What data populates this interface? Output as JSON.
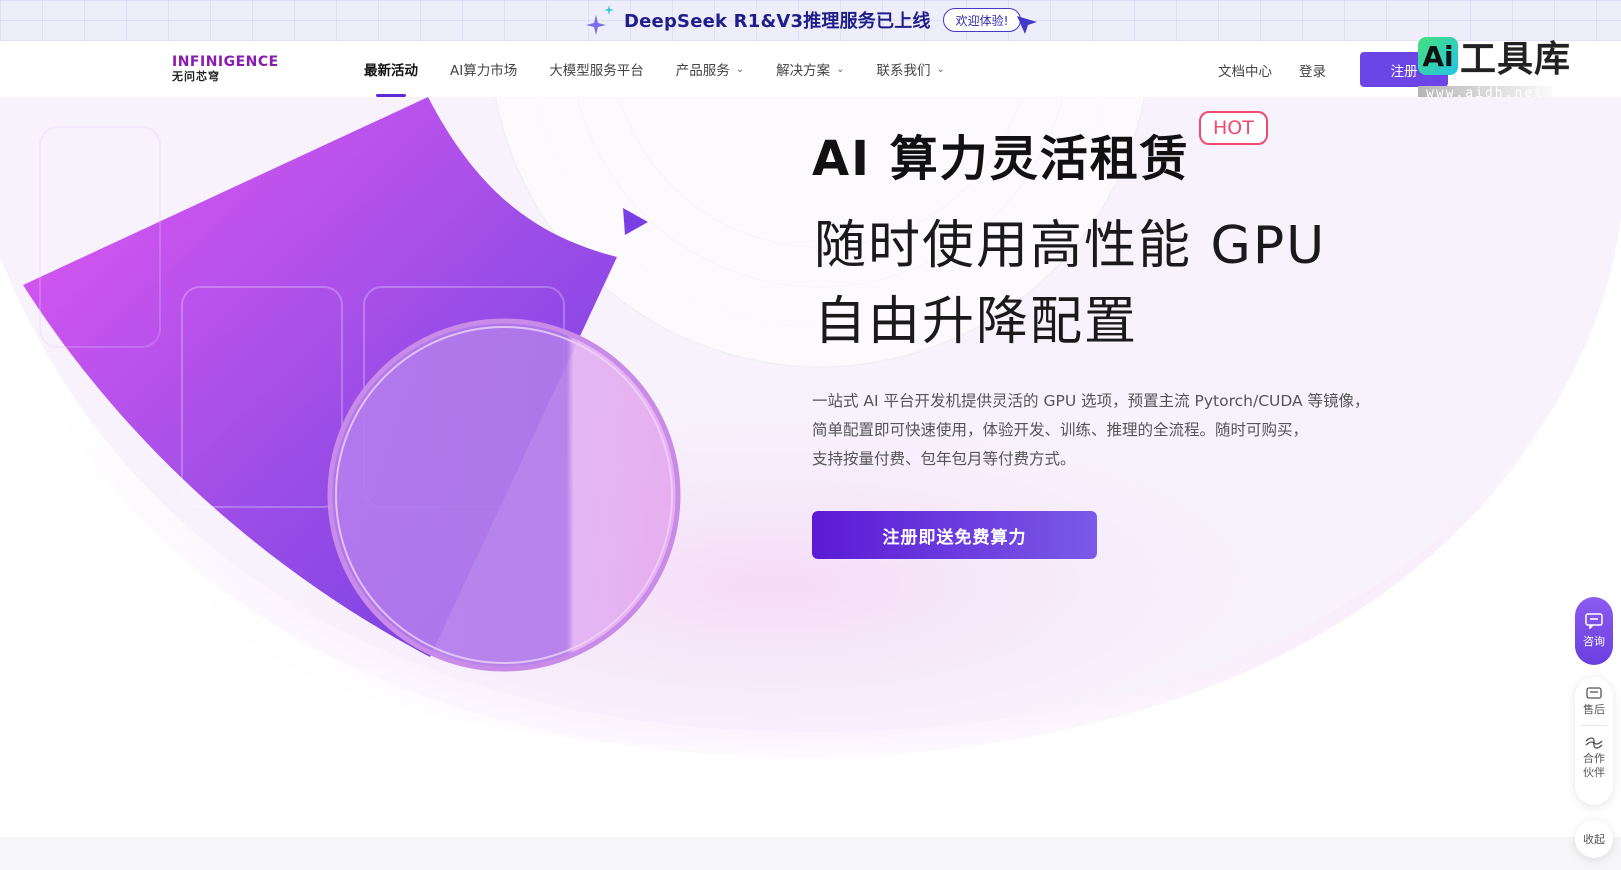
{
  "banner": {
    "text": "DeepSeek R1&V3推理服务已上线",
    "button": "欢迎体验!",
    "icons": [
      "sparkle-icon",
      "cursor-icon"
    ]
  },
  "nav": {
    "logo_top": "INFINIGENCE",
    "logo_bottom": "无问芯穹",
    "items": [
      {
        "label": "最新活动",
        "active": true,
        "dropdown": false
      },
      {
        "label": "AI算力市场",
        "active": false,
        "dropdown": false
      },
      {
        "label": "大模型服务平台",
        "active": false,
        "dropdown": false
      },
      {
        "label": "产品服务",
        "active": false,
        "dropdown": true
      },
      {
        "label": "解决方案",
        "active": false,
        "dropdown": true
      },
      {
        "label": "联系我们",
        "active": false,
        "dropdown": true
      }
    ],
    "docs": "文档中心",
    "login": "登录",
    "register": "注册"
  },
  "watermark": {
    "ai": "Ai",
    "title": "工具库",
    "url": "www.aidh.net"
  },
  "hero": {
    "title": "AI 算力灵活租赁",
    "badge": "HOT",
    "subtitle_line1": "随时使用高性能 GPU",
    "subtitle_line2": "自由升降配置",
    "desc_line1": "一站式 AI 平台开发机提供灵活的 GPU 选项，预置主流 Pytorch/CUDA 等镜像，",
    "desc_line2": "简单配置即可快速使用，体验开发、训练、推理的全流程。随时可购买，",
    "desc_line3": "支持按量付费、包年包月等付费方式。",
    "cta": "注册即送免费算力"
  },
  "side": {
    "consult": "咨询",
    "after_sales": "售后",
    "partner": "合作伙伴",
    "collapse": "收起"
  },
  "colors": {
    "brand": "#6b45e6",
    "hot": "#f04a6f",
    "banner_text": "#1f1d8a"
  }
}
